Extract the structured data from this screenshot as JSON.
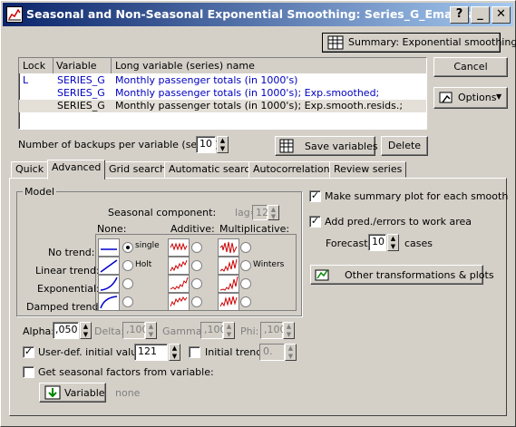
{
  "title": "Seasonal and Non-Seasonal Exponential Smoothing: Series_G_Ema.sta",
  "title_buttons": [
    "?",
    "_",
    "✕"
  ],
  "summary_button": "Summary:  Exponential smoothing",
  "cancel_button": "Cancel",
  "options_button": "Options",
  "table": {
    "headers": [
      "Lock",
      "Variable",
      "Long variable (series) name"
    ],
    "rows": [
      {
        "lock": "L",
        "variable": "SERIES_G",
        "name": "Monthly passenger totals (in 1000's)"
      },
      {
        "lock": "",
        "variable": "SERIES_G",
        "name": "Monthly passenger totals (in 1000's); Exp.smoothed;"
      },
      {
        "lock": "",
        "variable": "SERIES_G",
        "name": "Monthly passenger totals (in 1000's); Exp.smooth.resids.;"
      }
    ]
  },
  "backups_label": "Number of backups per variable (series):",
  "backups_value": "10",
  "save_variables": "Save variables",
  "delete": "Delete",
  "tabs": [
    "Quick",
    "Advanced",
    "Grid search",
    "Automatic search",
    "Autocorrelations",
    "Review series"
  ],
  "model": {
    "group_label": "Model",
    "seasonal_component": "Seasonal component:",
    "lag_label": "lag=",
    "lag_value": "12",
    "col_none": "None:",
    "col_additive": "Additive:",
    "col_multiplicative": "Multiplicative:",
    "rows": [
      "No trend:",
      "Linear trend:",
      "Exponential:",
      "Damped trend:"
    ],
    "single_label": "single",
    "holt_label": "Holt",
    "winters_label": "Winters"
  },
  "params": {
    "alpha_label": "Alpha:",
    "alpha_value": ",050",
    "delta_label": "Delta:",
    "delta_value": ",100",
    "gamma_label": "Gamma:",
    "gamma_value": ",100",
    "phi_label": "Phi:",
    "phi_value": ",100"
  },
  "userdef_label": "User-def. initial value:",
  "userdef_value": "121",
  "initial_trend_label": "Initial trend:",
  "initial_trend_value": "0.",
  "seasonal_factors_label": "Get seasonal factors from variable:",
  "variable_button": "Variable",
  "variable_none": "none",
  "summary_plot_label": "Make summary plot for each smooth",
  "add_pred_label": "Add pred./errors to work area",
  "forecast_label": "Forecast",
  "forecast_value": "10",
  "cases_label": "cases",
  "other_transform": "Other transformations & plots"
}
